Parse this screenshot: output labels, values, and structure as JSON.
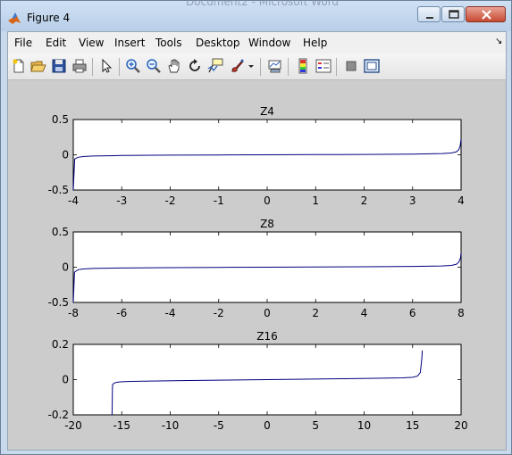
{
  "window": {
    "title": "Figure 4",
    "background_title": "Document2 - Microsoft Word"
  },
  "menu": {
    "items": [
      "File",
      "Edit",
      "View",
      "Insert",
      "Tools",
      "Desktop",
      "Window",
      "Help"
    ]
  },
  "toolbar": {
    "tools": [
      "new-figure-icon",
      "open-file-icon",
      "save-icon",
      "print-icon",
      "edit-plot-icon",
      "zoom-in-icon",
      "zoom-out-icon",
      "pan-icon",
      "rotate-3d-icon",
      "data-cursor-icon",
      "brush-icon",
      "brush-dropdown-icon",
      "link-plot-icon",
      "insert-colorbar-icon",
      "insert-legend-icon",
      "hide-plot-tools-icon",
      "show-plot-tools-icon"
    ]
  },
  "colors": {
    "line": "#00007f",
    "figure_bg": "#cccccc",
    "axes_bg": "#ffffff"
  },
  "chart_data": [
    {
      "type": "line",
      "title": "Z4",
      "xlim": [
        -4,
        4
      ],
      "ylim": [
        -0.5,
        0.5
      ],
      "xticks": [
        -4,
        -3,
        -2,
        -1,
        0,
        1,
        2,
        3,
        4
      ],
      "yticks": [
        -0.5,
        0,
        0.5
      ],
      "x_tick_labels": [
        "-4",
        "-3",
        "-2",
        "-1",
        "0",
        "1",
        "2",
        "3",
        "4"
      ],
      "y_tick_labels": [
        "-0.5",
        "0",
        "0.5"
      ],
      "x": [
        -4.0,
        -3.97,
        -3.9,
        -3.8,
        -3.6,
        -3.0,
        -2.0,
        -1.0,
        0.0,
        1.0,
        2.0,
        3.0,
        3.6,
        3.8,
        3.9,
        3.95,
        3.98,
        4.0
      ],
      "y": [
        -0.5,
        -0.06,
        -0.035,
        -0.025,
        -0.018,
        -0.01,
        -0.005,
        -0.002,
        0.0,
        0.002,
        0.005,
        0.01,
        0.018,
        0.025,
        0.04,
        0.07,
        0.12,
        0.22
      ]
    },
    {
      "type": "line",
      "title": "Z8",
      "xlim": [
        -8,
        8
      ],
      "ylim": [
        -0.5,
        0.5
      ],
      "xticks": [
        -8,
        -6,
        -4,
        -2,
        0,
        2,
        4,
        6,
        8
      ],
      "yticks": [
        -0.5,
        0,
        0.5
      ],
      "x_tick_labels": [
        "-8",
        "-6",
        "-4",
        "-2",
        "0",
        "2",
        "4",
        "6",
        "8"
      ],
      "y_tick_labels": [
        "-0.5",
        "0",
        "0.5"
      ],
      "x": [
        -8.0,
        -7.95,
        -7.8,
        -7.6,
        -7.2,
        -6.0,
        -4.0,
        -2.0,
        0.0,
        2.0,
        4.0,
        6.0,
        7.2,
        7.6,
        7.8,
        7.9,
        7.97,
        8.0
      ],
      "y": [
        -0.5,
        -0.07,
        -0.035,
        -0.025,
        -0.018,
        -0.012,
        -0.006,
        -0.003,
        0.0,
        0.003,
        0.006,
        0.012,
        0.018,
        0.025,
        0.04,
        0.07,
        0.12,
        0.2
      ]
    },
    {
      "type": "line",
      "title": "Z16",
      "xlim": [
        -20,
        20
      ],
      "ylim": [
        -0.2,
        0.2
      ],
      "xticks": [
        -20,
        -15,
        -10,
        -5,
        0,
        5,
        10,
        15,
        20
      ],
      "yticks": [
        -0.2,
        0,
        0.2
      ],
      "x_tick_labels": [
        "-20",
        "-15",
        "-10",
        "-5",
        "0",
        "5",
        "10",
        "15",
        "20"
      ],
      "y_tick_labels": [
        "-0.2",
        "0",
        "0.2"
      ],
      "x": [
        -16.0,
        -15.95,
        -15.8,
        -15.5,
        -15.0,
        -14.0,
        -12.0,
        -8.0,
        -4.0,
        0.0,
        4.0,
        8.0,
        12.0,
        14.0,
        15.0,
        15.5,
        15.8,
        15.95,
        16.0
      ],
      "y": [
        -0.2,
        -0.03,
        -0.02,
        -0.015,
        -0.012,
        -0.01,
        -0.008,
        -0.005,
        -0.0025,
        0.0,
        0.0025,
        0.005,
        0.008,
        0.01,
        0.013,
        0.02,
        0.04,
        0.12,
        0.165
      ]
    }
  ]
}
